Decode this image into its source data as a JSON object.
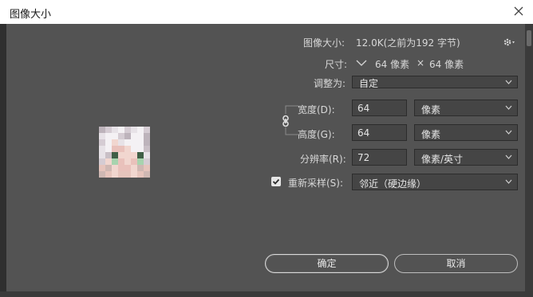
{
  "window": {
    "title": "图像大小"
  },
  "info": {
    "image_size_label": "图像大小:",
    "image_size_value": "12.0K(之前为192 字节)",
    "dimensions_label": "尺寸:",
    "dimensions_width": "64 像素",
    "dimensions_x": "×",
    "dimensions_height": "64 像素"
  },
  "fit": {
    "label": "调整为:",
    "value": "自定"
  },
  "width": {
    "label": "宽度(D):",
    "value": "64",
    "unit": "像素"
  },
  "height": {
    "label": "高度(G):",
    "value": "64",
    "unit": "像素"
  },
  "resolution": {
    "label": "分辨率(R):",
    "value": "72",
    "unit": "像素/英寸"
  },
  "resample": {
    "label": "重新采样(S):",
    "checked": true,
    "value": "邻近（硬边缘）"
  },
  "buttons": {
    "ok": "确定",
    "cancel": "取消"
  },
  "icons": {
    "close": "close-icon",
    "gear": "gear-icon",
    "link": "link-icon",
    "chevron": "chevron-down-icon"
  }
}
